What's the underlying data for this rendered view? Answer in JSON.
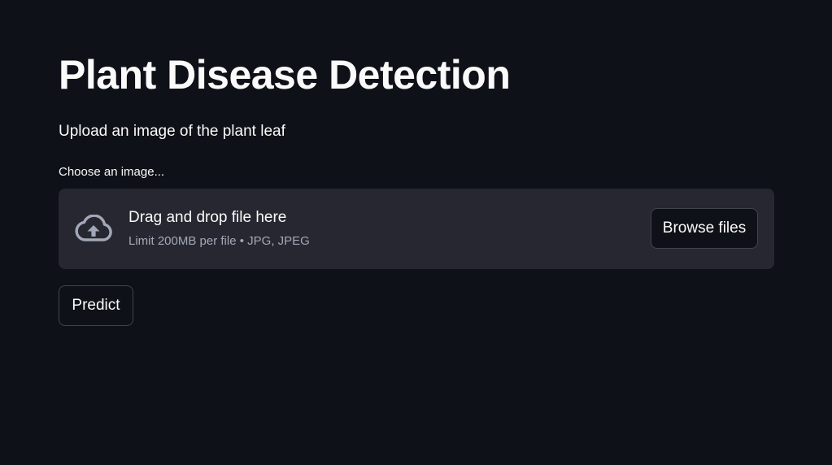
{
  "page": {
    "title": "Plant Disease Detection",
    "subtitle": "Upload an image of the plant leaf"
  },
  "uploader": {
    "label": "Choose an image...",
    "drop_text": "Drag and drop file here",
    "limit_text": "Limit 200MB per file • JPG, JPEG",
    "browse_label": "Browse files",
    "icon": "cloud-upload-icon"
  },
  "actions": {
    "predict_label": "Predict"
  },
  "colors": {
    "background": "#0e1117",
    "dropzone": "#262730",
    "text": "#fafafa",
    "muted_text": "#a3a8b8"
  }
}
